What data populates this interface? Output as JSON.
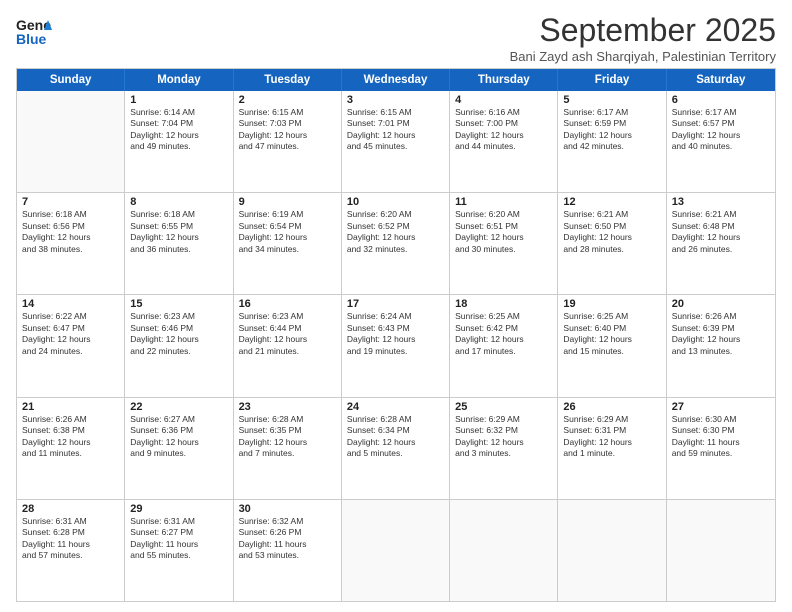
{
  "header": {
    "logo_line1": "General",
    "logo_line2": "Blue",
    "month": "September 2025",
    "location": "Bani Zayd ash Sharqiyah, Palestinian Territory"
  },
  "weekdays": [
    "Sunday",
    "Monday",
    "Tuesday",
    "Wednesday",
    "Thursday",
    "Friday",
    "Saturday"
  ],
  "rows": [
    [
      {
        "day": "",
        "info": ""
      },
      {
        "day": "1",
        "info": "Sunrise: 6:14 AM\nSunset: 7:04 PM\nDaylight: 12 hours\nand 49 minutes."
      },
      {
        "day": "2",
        "info": "Sunrise: 6:15 AM\nSunset: 7:03 PM\nDaylight: 12 hours\nand 47 minutes."
      },
      {
        "day": "3",
        "info": "Sunrise: 6:15 AM\nSunset: 7:01 PM\nDaylight: 12 hours\nand 45 minutes."
      },
      {
        "day": "4",
        "info": "Sunrise: 6:16 AM\nSunset: 7:00 PM\nDaylight: 12 hours\nand 44 minutes."
      },
      {
        "day": "5",
        "info": "Sunrise: 6:17 AM\nSunset: 6:59 PM\nDaylight: 12 hours\nand 42 minutes."
      },
      {
        "day": "6",
        "info": "Sunrise: 6:17 AM\nSunset: 6:57 PM\nDaylight: 12 hours\nand 40 minutes."
      }
    ],
    [
      {
        "day": "7",
        "info": "Sunrise: 6:18 AM\nSunset: 6:56 PM\nDaylight: 12 hours\nand 38 minutes."
      },
      {
        "day": "8",
        "info": "Sunrise: 6:18 AM\nSunset: 6:55 PM\nDaylight: 12 hours\nand 36 minutes."
      },
      {
        "day": "9",
        "info": "Sunrise: 6:19 AM\nSunset: 6:54 PM\nDaylight: 12 hours\nand 34 minutes."
      },
      {
        "day": "10",
        "info": "Sunrise: 6:20 AM\nSunset: 6:52 PM\nDaylight: 12 hours\nand 32 minutes."
      },
      {
        "day": "11",
        "info": "Sunrise: 6:20 AM\nSunset: 6:51 PM\nDaylight: 12 hours\nand 30 minutes."
      },
      {
        "day": "12",
        "info": "Sunrise: 6:21 AM\nSunset: 6:50 PM\nDaylight: 12 hours\nand 28 minutes."
      },
      {
        "day": "13",
        "info": "Sunrise: 6:21 AM\nSunset: 6:48 PM\nDaylight: 12 hours\nand 26 minutes."
      }
    ],
    [
      {
        "day": "14",
        "info": "Sunrise: 6:22 AM\nSunset: 6:47 PM\nDaylight: 12 hours\nand 24 minutes."
      },
      {
        "day": "15",
        "info": "Sunrise: 6:23 AM\nSunset: 6:46 PM\nDaylight: 12 hours\nand 22 minutes."
      },
      {
        "day": "16",
        "info": "Sunrise: 6:23 AM\nSunset: 6:44 PM\nDaylight: 12 hours\nand 21 minutes."
      },
      {
        "day": "17",
        "info": "Sunrise: 6:24 AM\nSunset: 6:43 PM\nDaylight: 12 hours\nand 19 minutes."
      },
      {
        "day": "18",
        "info": "Sunrise: 6:25 AM\nSunset: 6:42 PM\nDaylight: 12 hours\nand 17 minutes."
      },
      {
        "day": "19",
        "info": "Sunrise: 6:25 AM\nSunset: 6:40 PM\nDaylight: 12 hours\nand 15 minutes."
      },
      {
        "day": "20",
        "info": "Sunrise: 6:26 AM\nSunset: 6:39 PM\nDaylight: 12 hours\nand 13 minutes."
      }
    ],
    [
      {
        "day": "21",
        "info": "Sunrise: 6:26 AM\nSunset: 6:38 PM\nDaylight: 12 hours\nand 11 minutes."
      },
      {
        "day": "22",
        "info": "Sunrise: 6:27 AM\nSunset: 6:36 PM\nDaylight: 12 hours\nand 9 minutes."
      },
      {
        "day": "23",
        "info": "Sunrise: 6:28 AM\nSunset: 6:35 PM\nDaylight: 12 hours\nand 7 minutes."
      },
      {
        "day": "24",
        "info": "Sunrise: 6:28 AM\nSunset: 6:34 PM\nDaylight: 12 hours\nand 5 minutes."
      },
      {
        "day": "25",
        "info": "Sunrise: 6:29 AM\nSunset: 6:32 PM\nDaylight: 12 hours\nand 3 minutes."
      },
      {
        "day": "26",
        "info": "Sunrise: 6:29 AM\nSunset: 6:31 PM\nDaylight: 12 hours\nand 1 minute."
      },
      {
        "day": "27",
        "info": "Sunrise: 6:30 AM\nSunset: 6:30 PM\nDaylight: 11 hours\nand 59 minutes."
      }
    ],
    [
      {
        "day": "28",
        "info": "Sunrise: 6:31 AM\nSunset: 6:28 PM\nDaylight: 11 hours\nand 57 minutes."
      },
      {
        "day": "29",
        "info": "Sunrise: 6:31 AM\nSunset: 6:27 PM\nDaylight: 11 hours\nand 55 minutes."
      },
      {
        "day": "30",
        "info": "Sunrise: 6:32 AM\nSunset: 6:26 PM\nDaylight: 11 hours\nand 53 minutes."
      },
      {
        "day": "",
        "info": ""
      },
      {
        "day": "",
        "info": ""
      },
      {
        "day": "",
        "info": ""
      },
      {
        "day": "",
        "info": ""
      }
    ]
  ]
}
